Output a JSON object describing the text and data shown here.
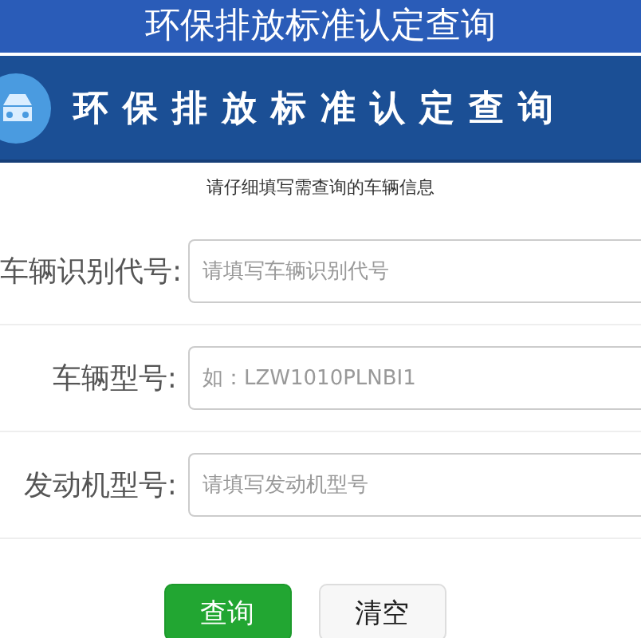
{
  "top_bar": {
    "title": "环保排放标准认定查询"
  },
  "banner": {
    "title": "环保排放标准认定查询"
  },
  "instructions": "请仔细填写需查询的车辆信息",
  "fields": [
    {
      "label": "车辆识别代号:",
      "placeholder": "请填写车辆识别代号"
    },
    {
      "label": "车辆型号:",
      "placeholder": "如：LZW1010PLNBI1"
    },
    {
      "label": "发动机型号:",
      "placeholder": "请填写发动机型号"
    }
  ],
  "buttons": [
    {
      "label": "查询",
      "kind": "primary"
    },
    {
      "label": "清空",
      "kind": "secondary"
    }
  ]
}
